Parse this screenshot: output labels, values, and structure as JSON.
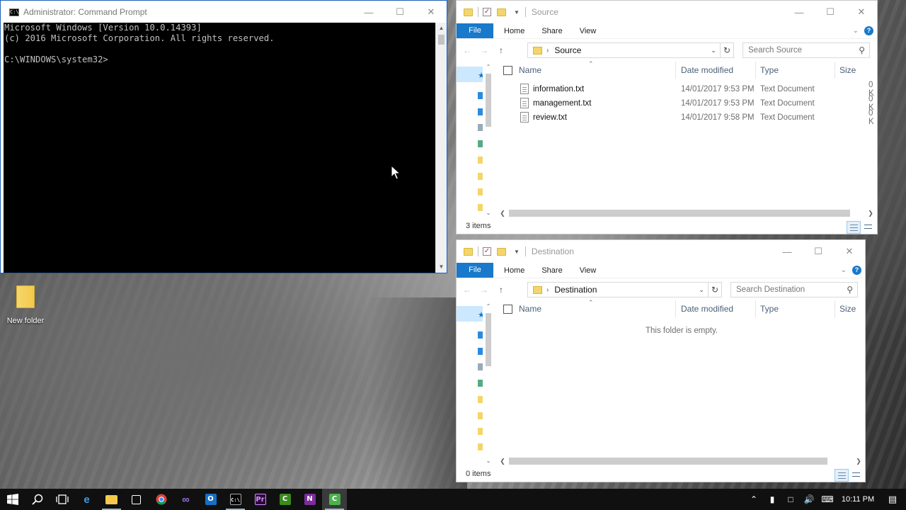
{
  "cmd": {
    "title": "Administrator: Command Prompt",
    "icon": "cmd-icon",
    "lines": [
      "Microsoft Windows [Version 10.0.14393]",
      "(c) 2016 Microsoft Corporation. All rights reserved.",
      "",
      "C:\\WINDOWS\\system32>"
    ]
  },
  "source": {
    "title": "Source",
    "ribbon": {
      "file": "File",
      "home": "Home",
      "share": "Share",
      "view": "View"
    },
    "path": "Source",
    "search_placeholder": "Search Source",
    "columns": {
      "name": "Name",
      "date": "Date modified",
      "type": "Type",
      "size": "Size"
    },
    "files": [
      {
        "name": "information.txt",
        "date": "14/01/2017 9:53 PM",
        "type": "Text Document",
        "size": "0 K"
      },
      {
        "name": "management.txt",
        "date": "14/01/2017 9:53 PM",
        "type": "Text Document",
        "size": "0 K"
      },
      {
        "name": "review.txt",
        "date": "14/01/2017 9:58 PM",
        "type": "Text Document",
        "size": "0 K"
      }
    ],
    "status": "3 items"
  },
  "destination": {
    "title": "Destination",
    "ribbon": {
      "file": "File",
      "home": "Home",
      "share": "Share",
      "view": "View"
    },
    "path": "Destination",
    "search_placeholder": "Search Destination",
    "columns": {
      "name": "Name",
      "date": "Date modified",
      "type": "Type",
      "size": "Size"
    },
    "empty_message": "This folder is empty.",
    "status": "0 items"
  },
  "desktop": {
    "folder_label": "New folder"
  },
  "taskbar": {
    "apps": [
      "windows-start",
      "search",
      "task-view",
      "edge",
      "file-explorer",
      "store",
      "chrome",
      "visual-studio",
      "outlook",
      "command-prompt",
      "premiere",
      "camtasia-green",
      "onenote",
      "camtasia"
    ],
    "clock": "10:11 PM"
  }
}
